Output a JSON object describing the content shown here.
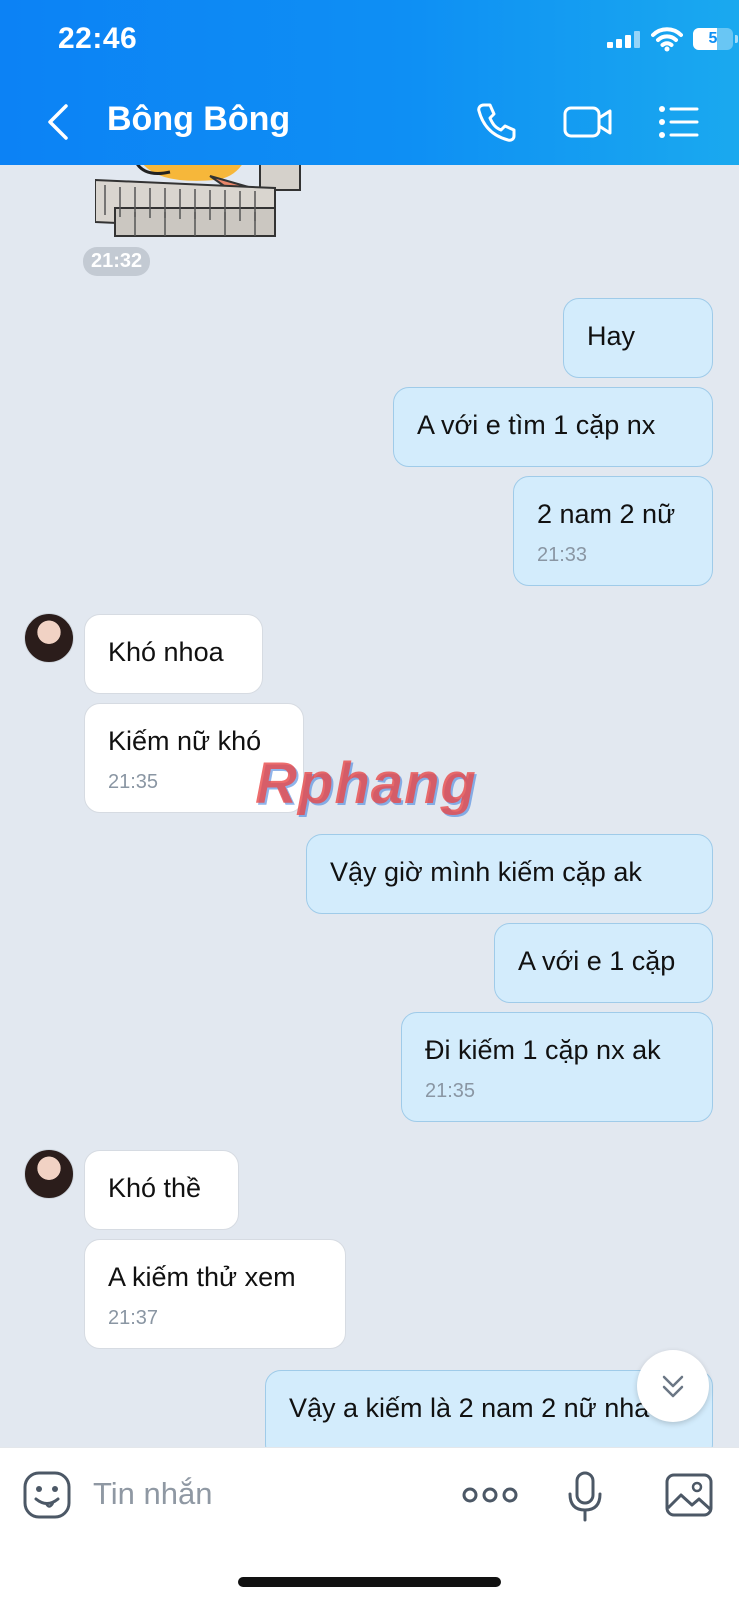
{
  "status": {
    "time": "22:46",
    "battery": "5"
  },
  "header": {
    "title": "Bông Bông"
  },
  "chat": {
    "sticker_time": "21:32",
    "messages": [
      {
        "text": "Hay"
      },
      {
        "text": "A với e tìm 1 cặp nx"
      },
      {
        "text": "2 nam 2 nữ",
        "time": "21:33"
      },
      {
        "text": "Khó nhoa"
      },
      {
        "text": "Kiếm nữ khó",
        "time": "21:35"
      },
      {
        "text": "Vậy giờ mình kiếm cặp ak"
      },
      {
        "text": "A với e 1 cặp"
      },
      {
        "text": "Đi kiếm 1 cặp nx ak",
        "time": "21:35"
      },
      {
        "text": "Khó thề"
      },
      {
        "text": "A kiếm thử xem",
        "time": "21:37"
      },
      {
        "text": "Vậy a kiếm là 2 nam 2 nữ nha"
      }
    ],
    "watermark": "Rphang"
  },
  "input": {
    "placeholder": "Tin nhắn"
  },
  "colors": {
    "header_blue": "#0e8ff4",
    "outgoing_bubble": "#d3ecfc",
    "incoming_bubble": "#ffffff",
    "chat_bg": "#e2e8f0"
  },
  "icons": [
    "back-icon",
    "phone-icon",
    "video-call-icon",
    "menu-icon",
    "emoji-icon",
    "more-icon",
    "microphone-icon",
    "image-icon",
    "chevron-double-down-icon"
  ]
}
